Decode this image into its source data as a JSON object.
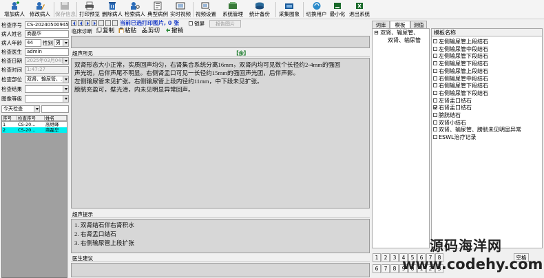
{
  "toolbar": {
    "buttons": [
      {
        "label": "增加病人",
        "icon": "add-patient-icon"
      },
      {
        "label": "修改病人",
        "icon": "edit-patient-icon"
      },
      {
        "label": "保存信息",
        "icon": "save-icon",
        "disabled": true
      },
      {
        "label": "打印预览",
        "icon": "print-preview-icon"
      },
      {
        "label": "删除病人",
        "icon": "delete-patient-icon"
      },
      {
        "label": "检索病人",
        "icon": "search-patient-icon"
      },
      {
        "label": "典型病例",
        "icon": "typical-case-icon"
      },
      {
        "label": "实时视频",
        "icon": "video-icon"
      },
      {
        "label": "视频设置",
        "icon": "video-settings-icon"
      },
      {
        "label": "系统管理",
        "icon": "system-admin-icon"
      },
      {
        "label": "统计备份",
        "icon": "stats-backup-icon"
      },
      {
        "label": "采集图象",
        "icon": "capture-image-icon"
      },
      {
        "label": "切换用户",
        "icon": "switch-user-icon"
      },
      {
        "label": "最小化",
        "icon": "minimize-icon"
      },
      {
        "label": "退出系统",
        "icon": "exit-icon"
      }
    ]
  },
  "patient_form": {
    "exam_no_label": "检查序号",
    "exam_no": "CS-20240500945",
    "name_label": "病人姓名",
    "name": "商磊华",
    "age_label": "病人年龄",
    "age": "44",
    "sex_label": "性别",
    "sex": "男",
    "doctor_label": "检查医生",
    "doctor": "admin",
    "date_label": "检查日期",
    "date": "2025年03月04日",
    "time_label": "检查时间",
    "time": "1:47:27",
    "part_label": "检查部位",
    "part": "双肾、输尿管、...",
    "result_label": "检查结果",
    "result": "",
    "grade_label": "图像等级",
    "grade": "",
    "filter": "今天检查"
  },
  "patient_table": {
    "headers": [
      "序号",
      "检查序号",
      "姓名"
    ],
    "rows": [
      {
        "no": "1",
        "exam_no": "CS-20...",
        "name": "高继峰"
      },
      {
        "no": "2",
        "exam_no": "CS-20...",
        "name": "商磊华"
      }
    ]
  },
  "print_bar": {
    "status": "当前已选打印图片, 0 张",
    "lock_label": "锁屏",
    "report_image_btn": "报告图片"
  },
  "editor_bar": {
    "clinical_label": "临床诊断",
    "copy": "复制",
    "paste": "粘贴",
    "cut": "剪切",
    "undo": "撤销"
  },
  "findings": {
    "header": "超声所见",
    "patient_tag": "【余】",
    "lines": [
      "双肾形态大小正常，实质回声均匀，右肾集合系统分离16mm，双肾内均可见数个长径约2-4mm的强回",
      "声光斑，后伴声尾不明显。右侧肾盂口可见一长径约15mm的强回声光团，后伴声影。",
      "左侧输尿管未见扩张。右侧输尿管上段内径约11mm，中下段未见扩张。",
      "膀胱充盈可，壁光滑，内未见明显异常回声。"
    ]
  },
  "hint": {
    "header": "超声提示",
    "lines": [
      "1. 双肾结石伴右肾积水",
      "2. 右肾盂口结石",
      "3. 右侧输尿管上段扩张"
    ]
  },
  "advice": {
    "header": "医生建议"
  },
  "right_panel": {
    "tabs": [
      "词库",
      "模板",
      "测值"
    ],
    "tree_items": [
      "双肾、输尿管、",
      "双肾、输尿管"
    ],
    "list_header": "模板名称",
    "templates": [
      {
        "name": "左侧输尿管上段结石",
        "checked": false
      },
      {
        "name": "左侧输尿管中段结石",
        "checked": false
      },
      {
        "name": "左侧输尿管下段结石",
        "checked": false
      },
      {
        "name": "左侧输尿管下段结石",
        "checked": false
      },
      {
        "name": "右侧输尿管上段结石",
        "checked": false
      },
      {
        "name": "右侧输尿管中段结石",
        "checked": false
      },
      {
        "name": "右侧输尿管下段结石",
        "checked": false
      },
      {
        "name": "右侧输尿管下段结石",
        "checked": false
      },
      {
        "name": "左肾盂口结石",
        "checked": false
      },
      {
        "name": "右肾盂口结石",
        "checked": true
      },
      {
        "name": "膀胱结石",
        "checked": false
      },
      {
        "name": "双肾小结石",
        "checked": false
      },
      {
        "name": "双肾、输尿管、膀胱未见明显异常",
        "checked": false
      },
      {
        "name": "ESWL治疗记录",
        "checked": false
      }
    ],
    "keys_row1": [
      "1",
      "2",
      "3",
      "4",
      "5",
      "6",
      "7",
      "8"
    ],
    "keys_row2": [
      "6",
      "7",
      "8",
      "9",
      "0",
      "1",
      "2",
      "3"
    ],
    "space_key": "空格"
  },
  "watermark": {
    "line1": "源码海洋网",
    "line2": "www.codehy.com"
  },
  "colors": {
    "selected_row": "#00f0f0",
    "text_area_bg": "#d7d7d7",
    "accent_blue": "#1a3cc8"
  }
}
